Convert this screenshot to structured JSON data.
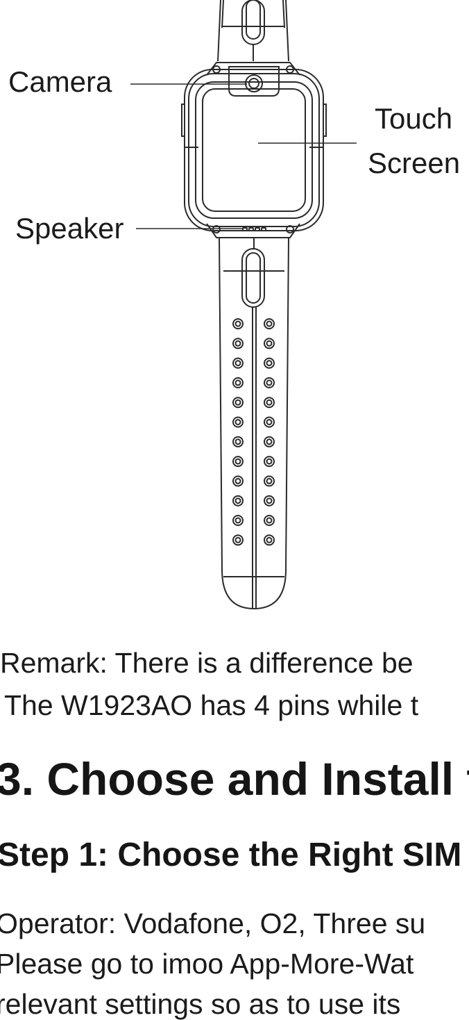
{
  "labels": {
    "camera": "Camera",
    "touch": "Touch",
    "screen": "Screen",
    "speaker": "Speaker"
  },
  "remark": {
    "line1": "Remark: There is a difference be",
    "line2": "The W1923AO has 4 pins while t"
  },
  "section": {
    "title": "3. Choose and Install t",
    "step": "Step 1: Choose the Right SIM"
  },
  "body": {
    "line1": "Operator: Vodafone, O2, Three su",
    "line2": "Please go to imoo App-More-Wat",
    "line3": "relevant settings so as to use its"
  },
  "colors": {
    "ink": "#1b1b1b",
    "line": "#2a2a2a"
  }
}
